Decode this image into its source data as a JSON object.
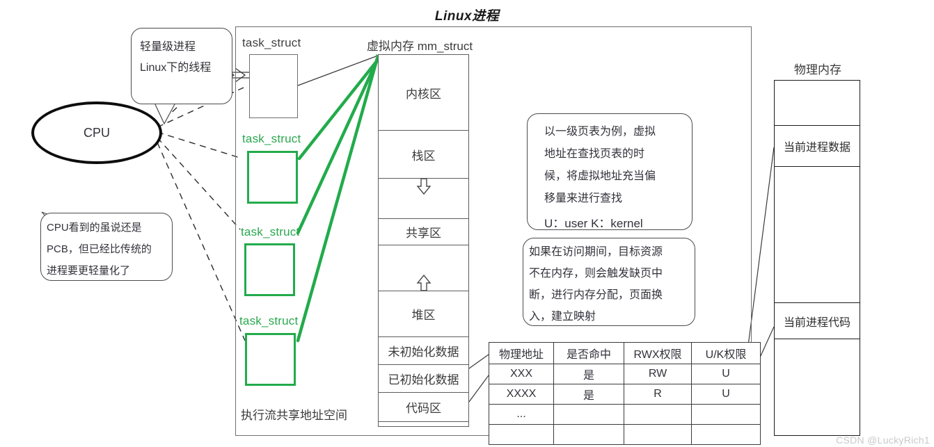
{
  "title": "Linux进程",
  "watermark": "CSDN @LuckyRich1",
  "cpu": {
    "label": "CPU"
  },
  "bubbles": {
    "lwp": {
      "line1": "轻量级进程",
      "line2": "Linux下的线程"
    },
    "pcb": {
      "line1": "CPU看到的虽说还是",
      "line2": "PCB，但已经比传统的",
      "line3": "进程要更轻量化了"
    },
    "pagetable": {
      "line1": "以一级页表为例，虚拟",
      "line2": "地址在查找页表的时",
      "line3": "候，将虚拟地址充当偏",
      "line4": "移量来进行查找",
      "line5": "U：user  K：kernel"
    },
    "pagefault": {
      "line1": "如果在访问期间，目标资源",
      "line2": "不在内存，则会触发缺页中",
      "line3": "断，进行内存分配，页面换",
      "line4": "入，建立映射"
    }
  },
  "task_structs": {
    "labels": [
      "task_struct",
      "task_struct",
      "task_struct",
      "task_struct"
    ],
    "footer": "执行流共享地址空间",
    "colors": {
      "first": "#404040",
      "thread": "#2aa84f"
    }
  },
  "mm_struct": {
    "title": "虚拟内存 mm_struct",
    "segments": [
      {
        "label": "内核区"
      },
      {
        "label": "栈区"
      },
      {
        "label": "",
        "icon": "arrow-down-icon"
      },
      {
        "label": "共享区"
      },
      {
        "label": "",
        "icon": "arrow-up-icon"
      },
      {
        "label": "堆区"
      },
      {
        "label": "未初始化数据"
      },
      {
        "label": "已初始化数据"
      },
      {
        "label": "代码区"
      },
      {
        "label": ""
      }
    ]
  },
  "physical_memory": {
    "title": "物理内存",
    "segments": [
      {
        "label": ""
      },
      {
        "label": "当前进程数据"
      },
      {
        "label": ""
      },
      {
        "label": "当前进程代码"
      },
      {
        "label": ""
      }
    ]
  },
  "page_table": {
    "headers": [
      "物理地址",
      "是否命中",
      "RWX权限",
      "U/K权限"
    ],
    "rows": [
      [
        "XXX",
        "是",
        "RW",
        "U"
      ],
      [
        "XXXX",
        "是",
        "R",
        "U"
      ],
      [
        "...",
        "",
        "",
        ""
      ],
      [
        "",
        "",
        "",
        ""
      ]
    ]
  }
}
